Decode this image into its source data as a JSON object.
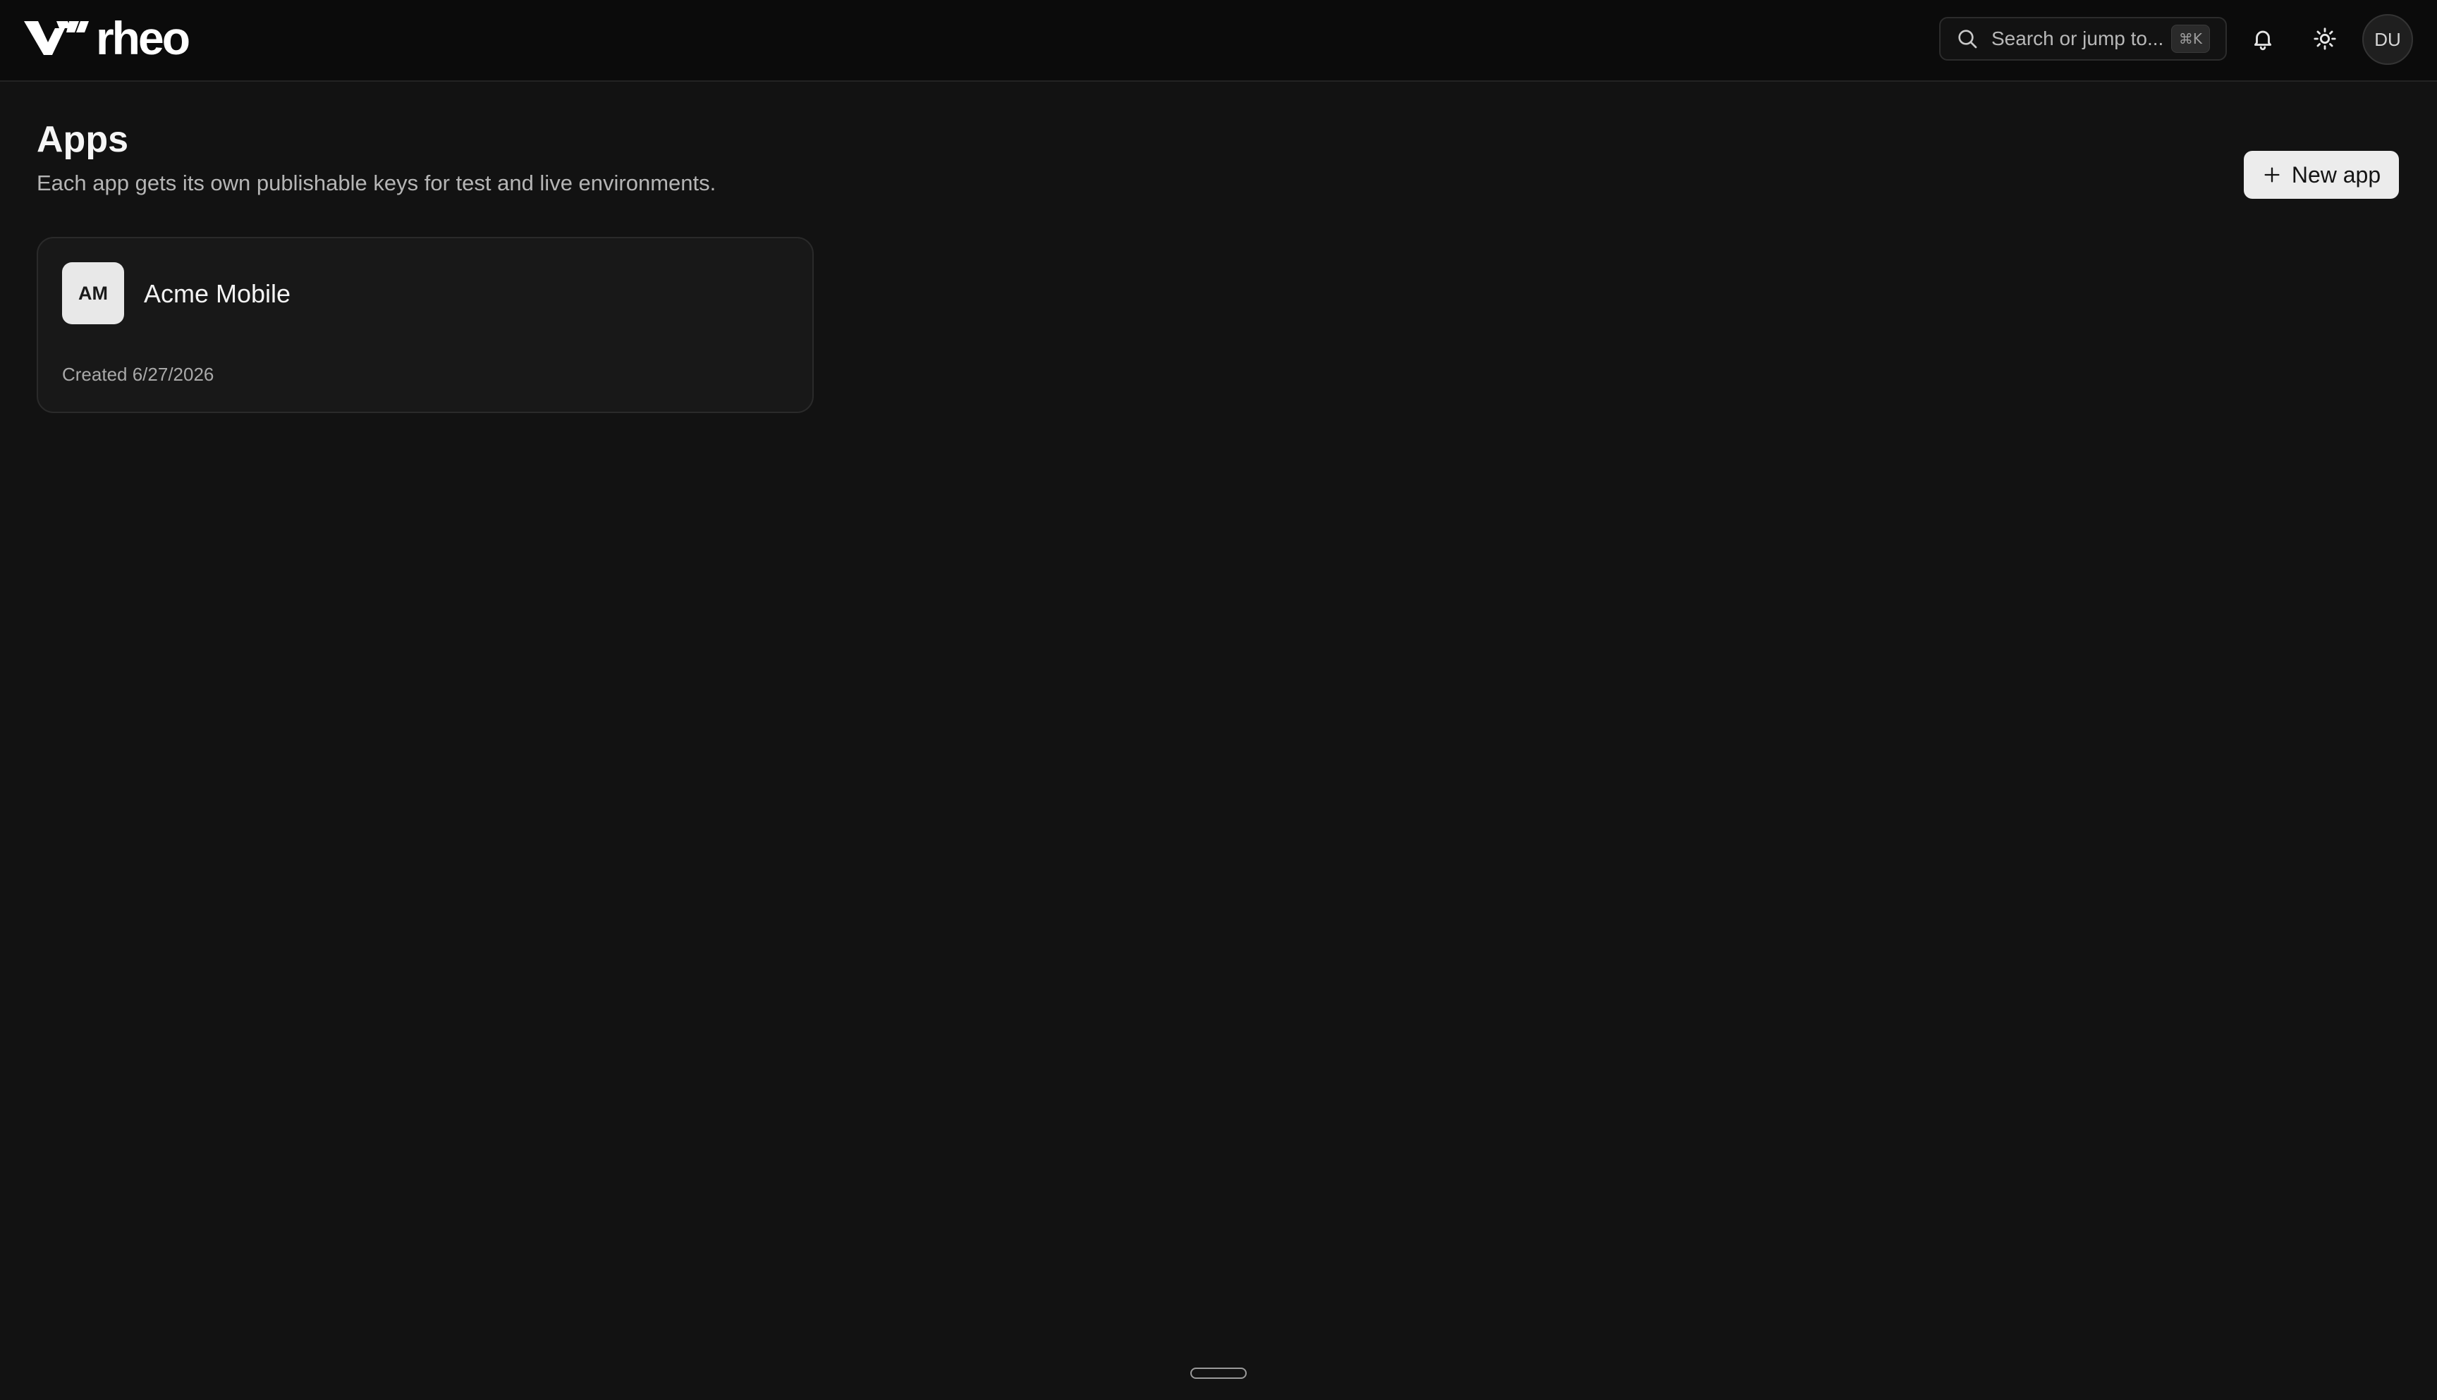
{
  "brand": {
    "name": "rheo"
  },
  "header": {
    "search": {
      "placeholder": "Search or jump to...",
      "shortcut": "⌘K",
      "icon": "search-icon"
    },
    "notifications": {
      "icon": "bell-icon"
    },
    "theme_toggle": {
      "icon": "sun-icon"
    },
    "user": {
      "initials": "DU"
    }
  },
  "main": {
    "title": "Apps",
    "subtitle": "Each app gets its own publishable keys for test and live environments.",
    "new_app_label": "New app",
    "apps": [
      {
        "initials": "AM",
        "name": "Acme Mobile",
        "created": "Created 6/27/2026"
      }
    ]
  },
  "colors": {
    "background": "#121212",
    "topbar": "#0b0b0b",
    "card": "#181818",
    "button_bg": "#ececec"
  }
}
